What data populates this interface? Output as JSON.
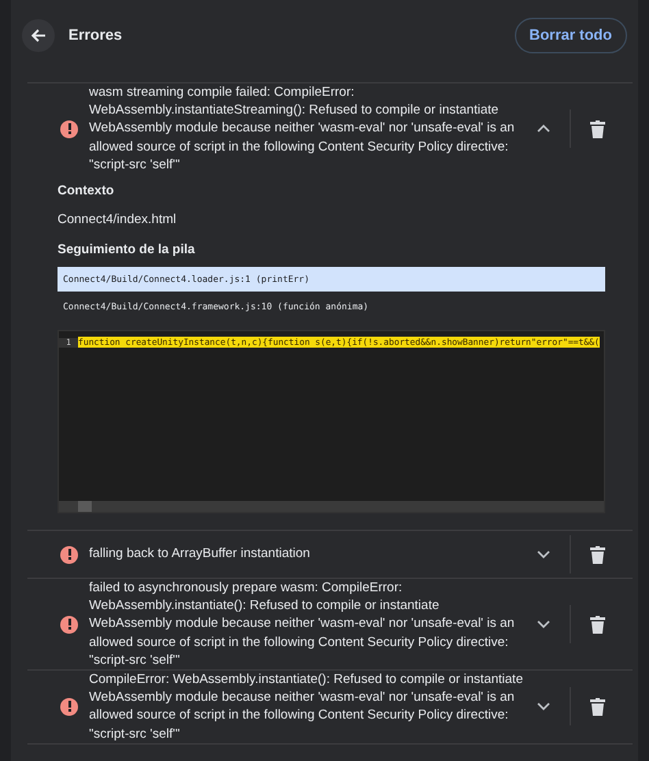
{
  "header": {
    "title": "Errores",
    "clear_button": "Borrar todo"
  },
  "errors": [
    {
      "message": "wasm streaming compile failed: CompileError: WebAssembly.instantiateStreaming(): Refused to compile or instantiate WebAssembly module because neither 'wasm-eval' nor 'unsafe-eval' is an allowed source of script in the following Content Security Policy directive: \"script-src 'self'\"",
      "expanded": true,
      "details": {
        "context_label": "Contexto",
        "context": "Connect4/index.html",
        "stack_label": "Seguimiento de la pila",
        "stack": [
          {
            "frame": "Connect4/Build/Connect4.loader.js:1 (printErr)",
            "selected": true
          },
          {
            "frame": "Connect4/Build/Connect4.framework.js:10 (función anónima)",
            "selected": false
          }
        ],
        "code": {
          "line_number": "1",
          "line": "function createUnityInstance(t,n,c){function s(e,t){if(!s.aborted&&n.showBanner)return\"error\"==t&&("
        }
      }
    },
    {
      "message": "falling back to ArrayBuffer instantiation",
      "expanded": false
    },
    {
      "message": "failed to asynchronously prepare wasm: CompileError: WebAssembly.instantiate(): Refused to compile or instantiate WebAssembly module because neither 'wasm-eval' nor 'unsafe-eval' is an allowed source of script in the following Content Security Policy directive: \"script-src 'self'\"",
      "expanded": false
    },
    {
      "message": "CompileError: WebAssembly.instantiate(): Refused to compile or instantiate WebAssembly module because neither 'wasm-eval' nor 'unsafe-eval' is an allowed source of script in the following Content Security Policy directive: \"script-src 'self'\"",
      "expanded": false
    }
  ]
}
